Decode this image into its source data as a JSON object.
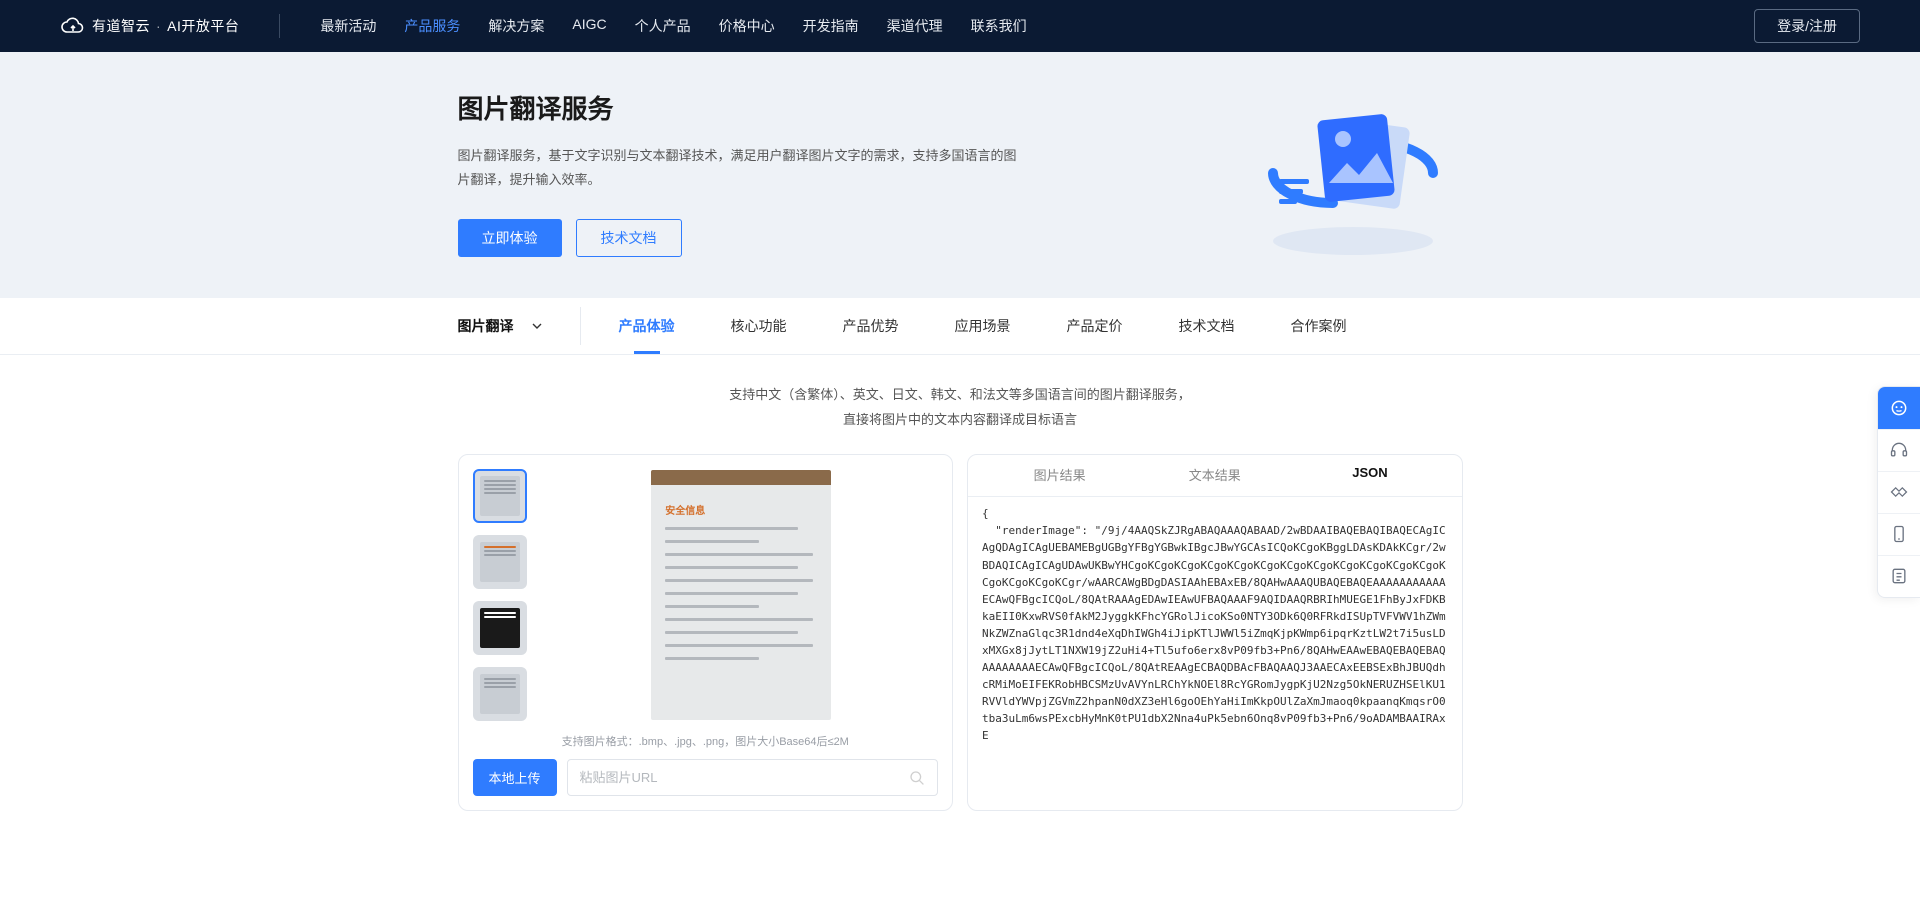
{
  "brand": {
    "name": "有道智云",
    "suffix": "AI开放平台"
  },
  "nav": {
    "items": [
      "最新活动",
      "产品服务",
      "解决方案",
      "AIGC",
      "个人产品",
      "价格中心",
      "开发指南",
      "渠道代理",
      "联系我们"
    ],
    "active_index": 1,
    "login": "登录/注册"
  },
  "hero": {
    "title": "图片翻译服务",
    "desc": "图片翻译服务，基于文字识别与文本翻译技术，满足用户翻译图片文字的需求，支持多国语言的图片翻译，提升输入效率。",
    "btn_primary": "立即体验",
    "btn_secondary": "技术文档"
  },
  "category": {
    "label": "图片翻译"
  },
  "tabs": {
    "items": [
      "产品体验",
      "核心功能",
      "产品优势",
      "应用场景",
      "产品定价",
      "技术文档",
      "合作案例"
    ],
    "active_index": 0
  },
  "section": {
    "desc_line1": "支持中文（含繁体）、英文、日文、韩文、和法文等多国语言间的图片翻译服务，",
    "desc_line2": "直接将图片中的文本内容翻译成目标语言"
  },
  "left_panel": {
    "format_hint": "支持图片格式：.bmp、.jpg、.png，图片大小Base64后≤2M",
    "upload_btn": "本地上传",
    "url_placeholder": "粘贴图片URL"
  },
  "preview_heading": "安全信息",
  "result_tabs": {
    "items": [
      "图片结果",
      "文本结果",
      "JSON"
    ],
    "active_index": 2
  },
  "json_output": "{\n  \"renderImage\": \"/9j/4AAQSkZJRgABAQAAAQABAAD/2wBDAAIBAQEBAQIBAQECAgICAgQDAgICAgUEBAMEBgUGBgYFBgYGBwkIBgcJBwYGCAsICQoKCgoKBggLDAsKDAkKCgr/2wBDAQICAgICAgUDAwUKBwYHCgoKCgoKCgoKCgoKCgoKCgoKCgoKCgoKCgoKCgoKCgoKCgoKCgoKCgoKCgoKCgr/wAARCAWgBDgDASIAAhEBAxEB/8QAHwAAAQUBAQEBAQEAAAAAAAAAAAECAwQFBgcICQoL/8QAtRAAAgEDAwIEAwUFBAQAAAF9AQIDAAQRBRIhMUEGE1FhByJxFDKBkaEII0KxwRVS0fAkM2JyggkKFhcYGRolJicoKSo0NTY3ODk6Q0RFRkdISUpTVFVWV1hZWmNkZWZnaGlqc3R1dnd4eXqDhIWGh4iJipKTlJWWl5iZmqKjpKWmp6ipqrKztLW2t7i5usLDxMXGx8jJytLT1NXW19jZ2uHi4+Tl5ufo6erx8vP09fb3+Pn6/8QAHwEAAwEBAQEBAQEBAQAAAAAAAAECAwQFBgcICQoL/8QAtREAAgECBAQDBAcFBAQAAQJ3AAECAxEEBSExBhJBUQdhcRMiMoEIFEKRobHBCSMzUvAVYnLRChYkNOEl8RcYGRomJygpKjU2Nzg5OkNERUZHSElKU1RVVldYWVpjZGVmZ2hpanN0dXZ3eHl6goOEhYaHiImKkpOUlZaXmJmaoq0kpaanqKmqsrO0tba3uLm6wsPExcbHyMnK0tPU1dbX2Nna4uPk5ebn6Onq8vP09fb3+Pn6/9oADAMBAAIRAxE"
}
